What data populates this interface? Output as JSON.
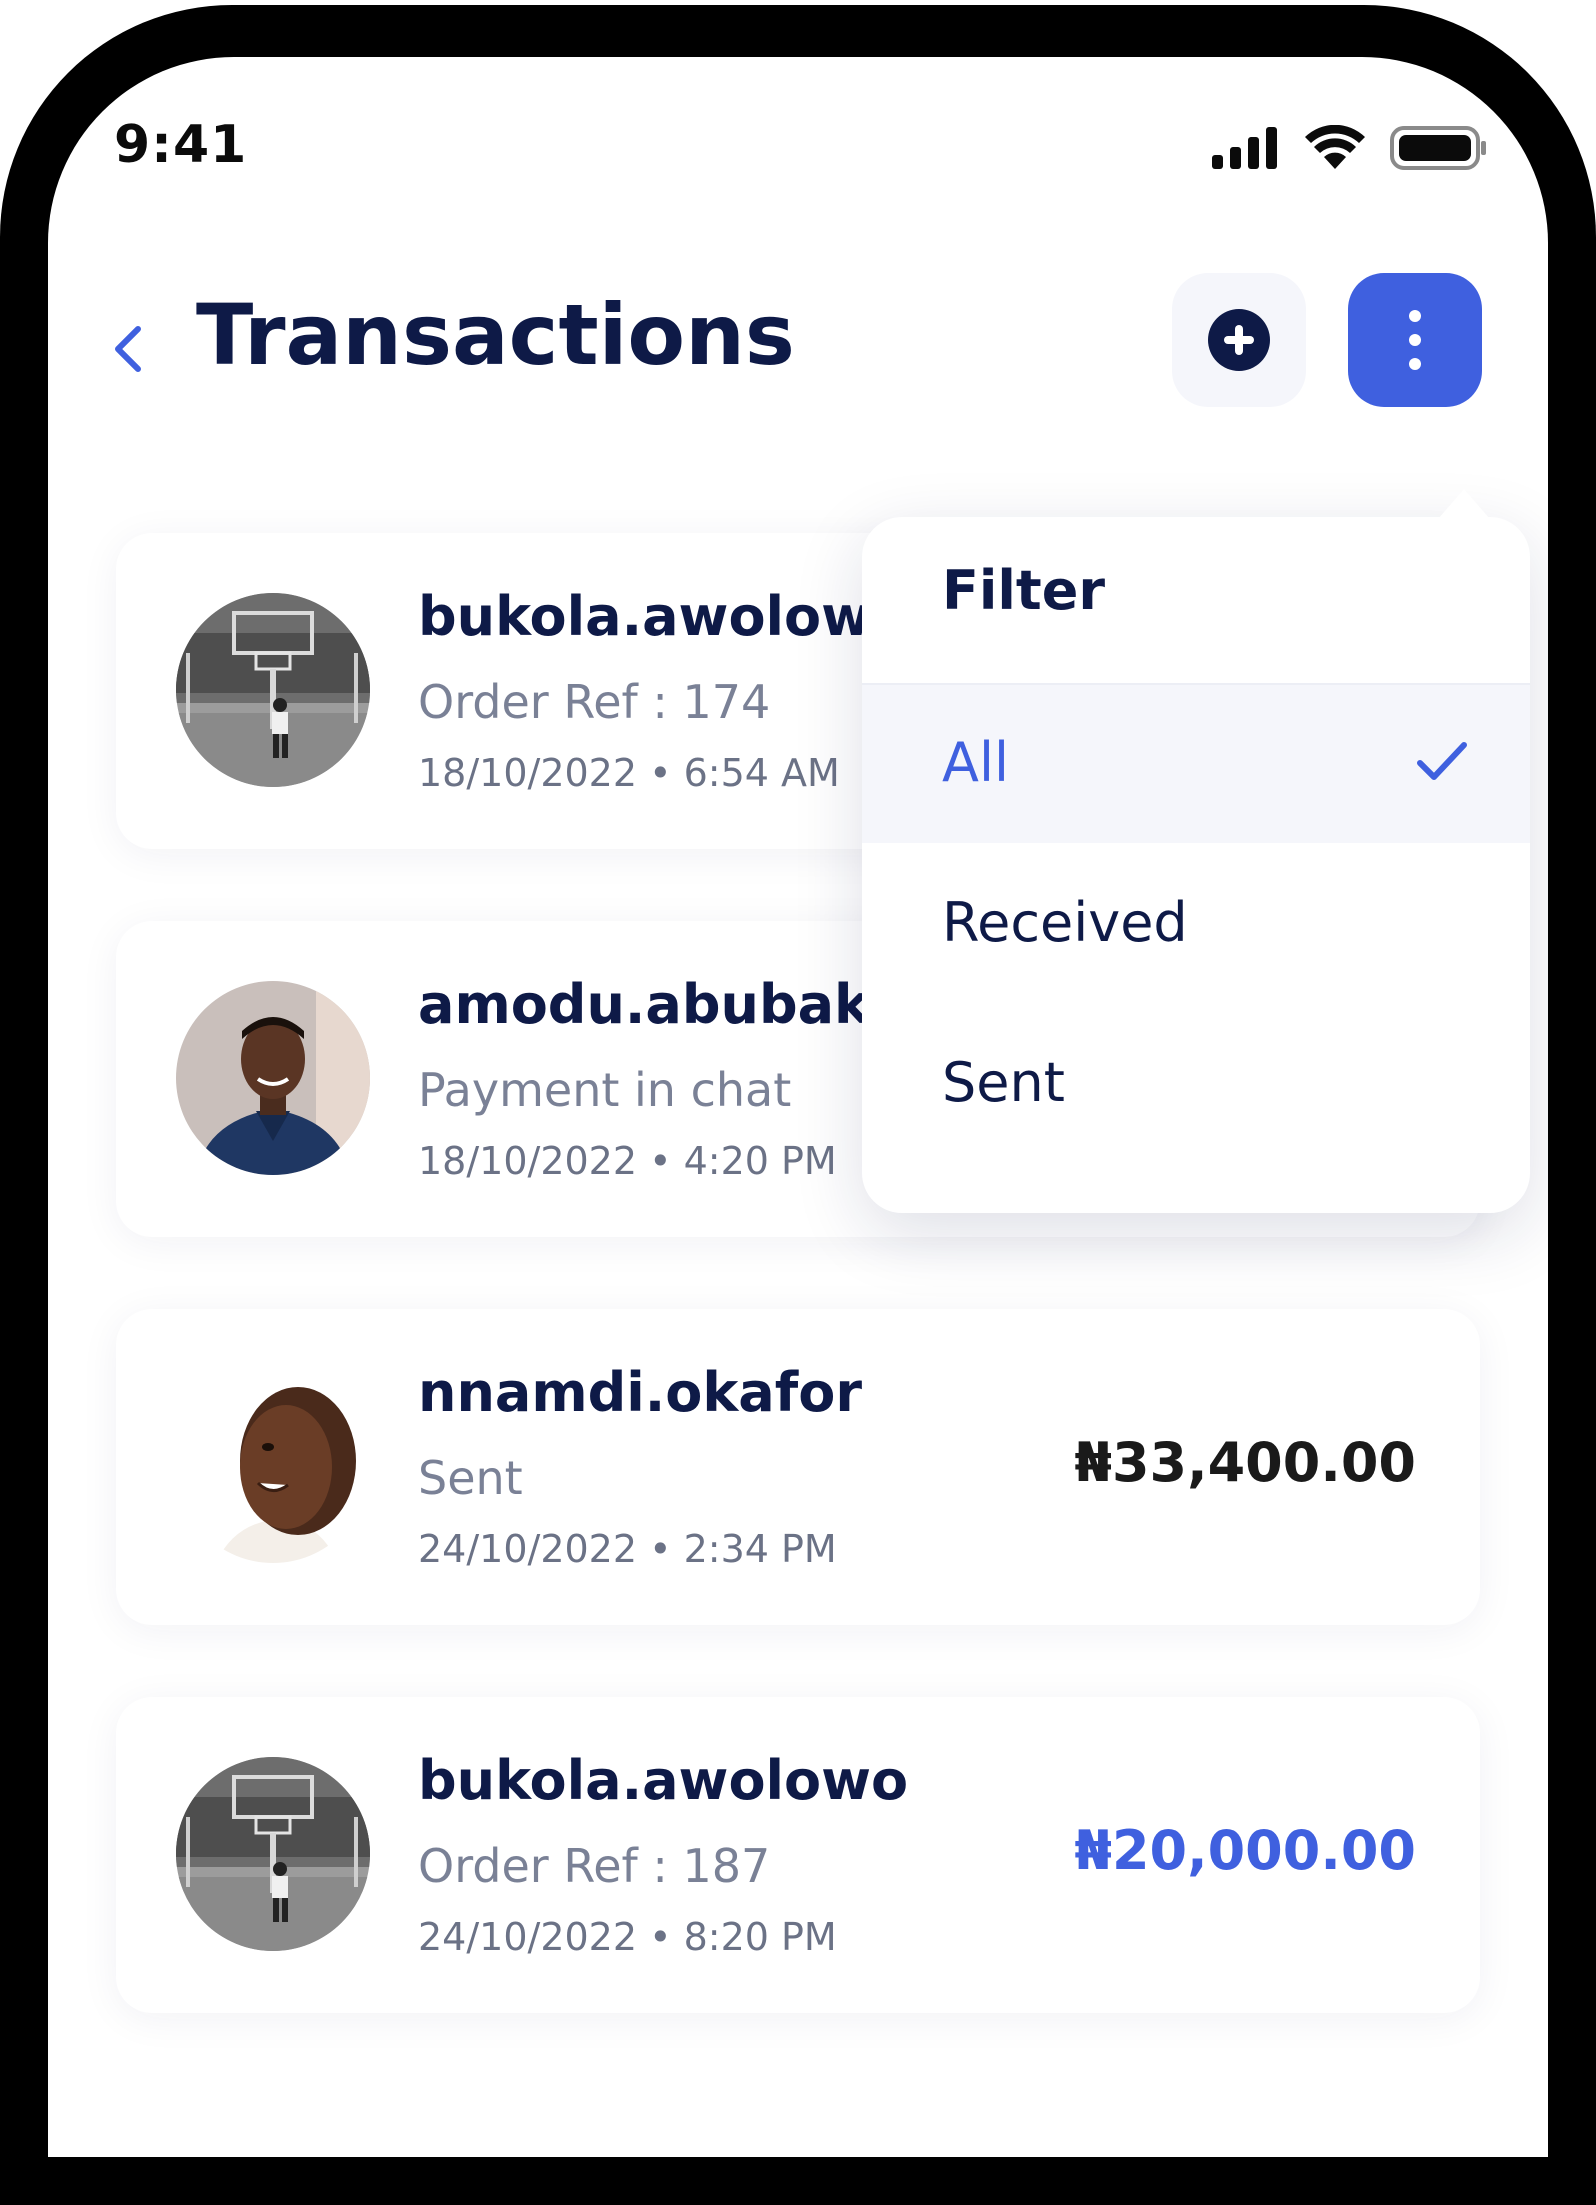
{
  "status_bar": {
    "time": "9:41",
    "icons": [
      "cellular-signal-icon",
      "wifi-icon",
      "battery-icon"
    ]
  },
  "header": {
    "title": "Transactions",
    "back_icon": "chevron-left-icon",
    "add_icon": "plus-circle-icon",
    "more_icon": "more-vertical-icon"
  },
  "colors": {
    "accent": "#3f60df",
    "title": "#0e1a47",
    "muted": "#7a8196",
    "frame": "#000000"
  },
  "filter_menu": {
    "title": "Filter",
    "options": [
      {
        "label": "All",
        "selected": true
      },
      {
        "label": "Received",
        "selected": false
      },
      {
        "label": "Sent",
        "selected": false
      }
    ],
    "check_icon": "checkmark-icon"
  },
  "transactions": [
    {
      "name": "bukola.awolowo",
      "description": "Order Ref : 174",
      "date": "18/10/2022 • 6:54 AM",
      "amount": "",
      "avatar": "basketball-player-photo"
    },
    {
      "name": "amodu.abubakar",
      "description": "Payment in chat",
      "date": "18/10/2022 • 4:20 PM",
      "amount": "",
      "avatar": "man-blue-shirt-photo"
    },
    {
      "name": "nnamdi.okafor",
      "description": "Sent",
      "date": "24/10/2022 • 2:34 PM",
      "amount": "₦33,400.00",
      "amount_color": "#1a1a1a",
      "avatar": "smiling-man-profile-photo"
    },
    {
      "name": "bukola.awolowo",
      "description": "Order Ref : 187",
      "date": "24/10/2022 • 8:20 PM",
      "amount": "₦20,000.00",
      "amount_color": "#3f60df",
      "avatar": "basketball-player-photo"
    }
  ]
}
